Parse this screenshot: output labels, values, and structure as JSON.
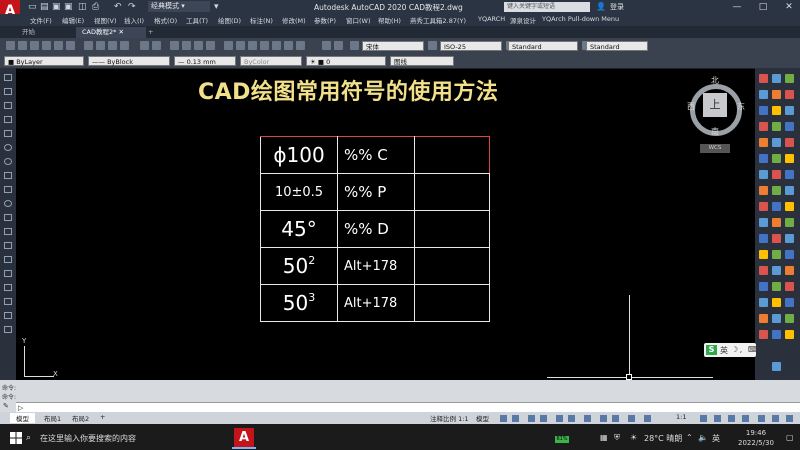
{
  "title_bar": {
    "logo_letter": "A",
    "workspace": "经典模式",
    "window_title": "Autodesk AutoCAD 2020    CAD教程2.dwg",
    "search_placeholder": "键入关键字或短语",
    "login": "登录",
    "controls": [
      "—",
      "□",
      "✕"
    ]
  },
  "menu": [
    "文件(F)",
    "编辑(E)",
    "视图(V)",
    "插入(I)",
    "格式(O)",
    "工具(T)",
    "绘图(D)",
    "标注(N)",
    "修改(M)",
    "参数(P)",
    "窗口(W)",
    "帮助(H)",
    "燕秀工具箱2.87(Y)",
    "YQARCH",
    "源泉设计",
    "YQArch Pull-down Menu"
  ],
  "doc_tabs": {
    "start": "开始",
    "active": "CAD教程2*",
    "add": "+"
  },
  "toolbar": {
    "font": "宋体",
    "dim_style": "ISO-25",
    "table_style": "Standard",
    "multileader_style": "Standard",
    "layer": "0",
    "color": "ByLayer",
    "linetype": "ByBlock",
    "lineweight": "0.13 mm",
    "plot_style": "ByColor",
    "layer_state": "图线"
  },
  "viewcube": {
    "north": "北",
    "south": "南",
    "east": "东",
    "west": "西",
    "face": "上",
    "wcs": "WCS"
  },
  "drawing": {
    "heading": "CAD绘图常用符号的使用方法",
    "rows": [
      {
        "sample": "ϕ100",
        "code": "%% C",
        "note": ""
      },
      {
        "sample": "10±0.5",
        "code": "%% P",
        "note": ""
      },
      {
        "sample": "45°",
        "code": "%% D",
        "note": ""
      },
      {
        "sample_base": "50",
        "sample_exp": "2",
        "code": "Alt+178",
        "note": ""
      },
      {
        "sample_base": "50",
        "sample_exp": "3",
        "code": "Alt+178",
        "note": ""
      }
    ],
    "ucs_y": "Y",
    "ucs_x": "X"
  },
  "command": {
    "line1": "命令:",
    "line2": "命令:",
    "prompt": "▷"
  },
  "layout_tabs": [
    "模型",
    "布局1",
    "布局2",
    "+"
  ],
  "status": {
    "annotation_text": "注释比例 1:1",
    "model": "模型",
    "scale": "1:1"
  },
  "taskbar": {
    "search": "在这里输入你要搜索的内容",
    "app_letter": "A",
    "battery": "61%",
    "weather": "28°C 晴朗",
    "ime": "英",
    "time": "19:46",
    "date": "2022/5/30"
  },
  "ime_bar": {
    "logo": "S",
    "lang": "英"
  }
}
